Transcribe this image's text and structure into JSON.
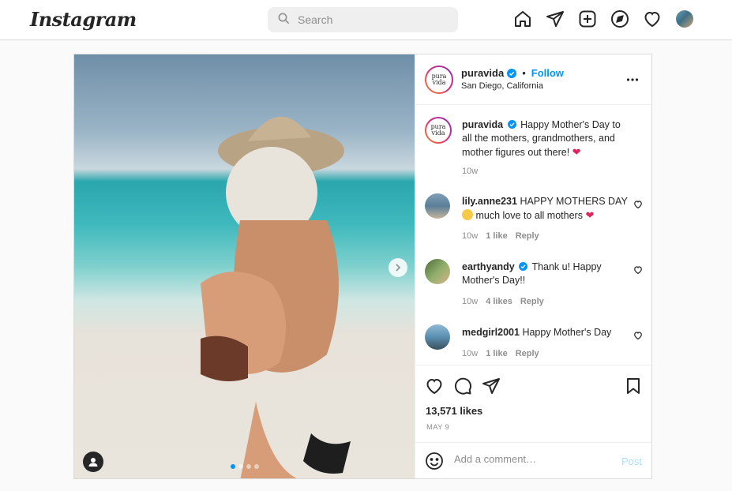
{
  "brand": {
    "logo_text": "Instagram"
  },
  "search": {
    "placeholder": "Search",
    "icon": "search-icon"
  },
  "nav": {
    "icons": [
      "home-icon",
      "send-icon",
      "new-post-icon",
      "explore-icon",
      "heart-icon",
      "profile-avatar"
    ]
  },
  "post": {
    "author": {
      "username": "puravida",
      "avatar_text": "pura vida",
      "verified": true,
      "follow_label": "Follow",
      "separator": "•",
      "location": "San Diego, California"
    },
    "caption": {
      "username": "puravida",
      "text": "Happy Mother's Day to all the mothers, grandmothers, and mother figures out there!",
      "emoji": "❤",
      "time": "10w"
    },
    "comments": [
      {
        "username": "lily.anne231",
        "text_pre": "HAPPY MOTHERS DAY",
        "text_post": "much love to all mothers",
        "emoji_end": "❤",
        "time": "10w",
        "likes": "1 like",
        "reply": "Reply"
      },
      {
        "username": "earthyandy",
        "verified": true,
        "text": "Thank u! Happy Mother's Day!!",
        "time": "10w",
        "likes": "4 likes",
        "reply": "Reply"
      },
      {
        "username": "medgirl2001",
        "text": "Happy Mother's Day",
        "time": "10w",
        "likes": "1 like",
        "reply": "Reply"
      }
    ],
    "likes_text": "13,571 likes",
    "date": "MAY 9",
    "add_comment_placeholder": "Add a comment…",
    "post_button": "Post",
    "carousel": {
      "slides": 4,
      "active": 1
    }
  },
  "colors": {
    "accent": "#0095f6",
    "border": "#dbdbdb",
    "muted": "#8e8e8e",
    "heart_red": "#e0245e"
  }
}
